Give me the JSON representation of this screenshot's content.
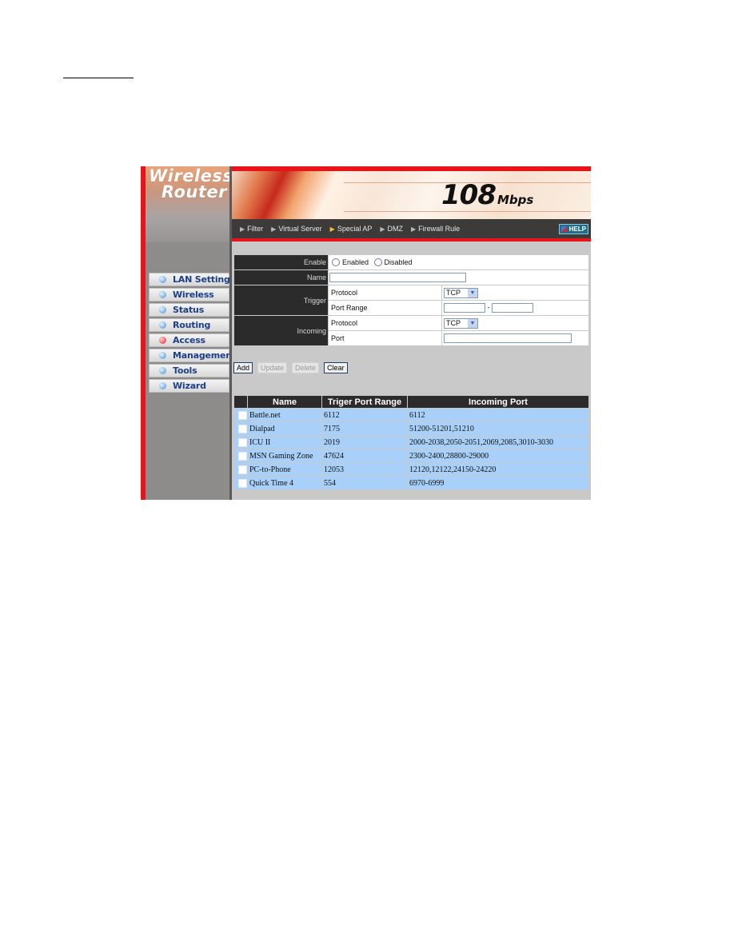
{
  "brand": {
    "logo_line1": "Wireless",
    "logo_line2": "Router",
    "speed_number": "108",
    "speed_unit": "Mbps"
  },
  "sidebar": {
    "items": [
      {
        "label": "LAN Setting",
        "active": false
      },
      {
        "label": "Wireless",
        "active": false
      },
      {
        "label": "Status",
        "active": false
      },
      {
        "label": "Routing",
        "active": false
      },
      {
        "label": "Access",
        "active": true
      },
      {
        "label": "Management",
        "active": false
      },
      {
        "label": "Tools",
        "active": false
      },
      {
        "label": "Wizard",
        "active": false
      }
    ]
  },
  "tabs": {
    "items": [
      {
        "label": "Filter",
        "active": false
      },
      {
        "label": "Virtual Server",
        "active": false
      },
      {
        "label": "Special AP",
        "active": true
      },
      {
        "label": "DMZ",
        "active": false
      },
      {
        "label": "Firewall Rule",
        "active": false
      }
    ],
    "help_label": "HELP"
  },
  "form": {
    "enable_label": "Enable",
    "enabled_option": "Enabled",
    "disabled_option": "Disabled",
    "name_label": "Name",
    "name_value": "",
    "trigger_label": "Trigger",
    "trigger_protocol_label": "Protocol",
    "trigger_protocol_value": "TCP",
    "trigger_port_range_label": "Port Range",
    "trigger_port_from": "",
    "trigger_port_to": "",
    "range_separator": "-",
    "incoming_label": "Incoming",
    "incoming_protocol_label": "Protocol",
    "incoming_protocol_value": "TCP",
    "incoming_port_label": "Port",
    "incoming_port_value": ""
  },
  "buttons": {
    "add": "Add",
    "update": "Update",
    "delete": "Delete",
    "clear": "Clear"
  },
  "table": {
    "headers": [
      "",
      "Name",
      "Triger Port Range",
      "Incoming Port"
    ],
    "rows": [
      {
        "name": "Battle.net",
        "trigger": "6112",
        "incoming": "6112"
      },
      {
        "name": "Dialpad",
        "trigger": "7175",
        "incoming": "51200-51201,51210"
      },
      {
        "name": "ICU II",
        "trigger": "2019",
        "incoming": "2000-2038,2050-2051,2069,2085,3010-3030"
      },
      {
        "name": "MSN Gaming Zone",
        "trigger": "47624",
        "incoming": "2300-2400,28800-29000"
      },
      {
        "name": "PC-to-Phone",
        "trigger": "12053",
        "incoming": "12120,12122,24150-24220"
      },
      {
        "name": "Quick Time 4",
        "trigger": "554",
        "incoming": "6970-6999"
      }
    ]
  }
}
